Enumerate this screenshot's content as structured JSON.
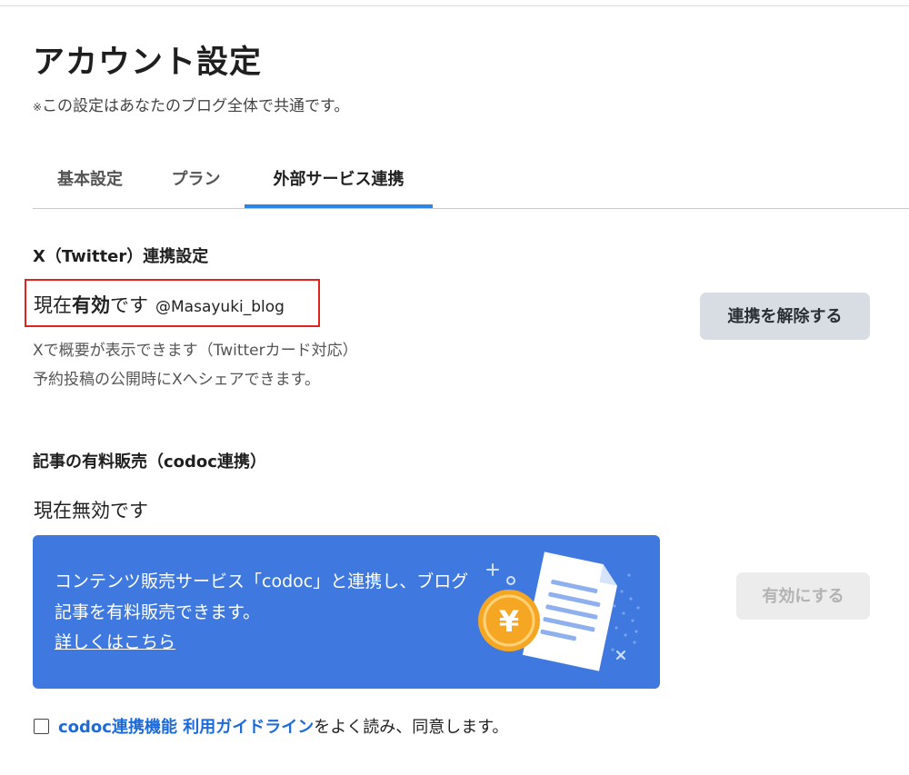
{
  "page": {
    "title": "アカウント設定",
    "note_mark": "※",
    "note_text": "この設定はあなたのブログ全体で共通です。"
  },
  "tabs": [
    {
      "label": "基本設定",
      "active": false
    },
    {
      "label": "プラン",
      "active": false
    },
    {
      "label": "外部サービス連携",
      "active": true
    }
  ],
  "twitter": {
    "heading": "X（Twitter）連携設定",
    "status_prefix": "現在",
    "status_bold": "有効",
    "status_suffix": "です",
    "handle": "@Masayuki_blog",
    "desc_1": "Xで概要が表示できます（Twitterカード対応）",
    "desc_2": "予約投稿の公開時にXへシェアできます。",
    "unlink_button": "連携を解除する"
  },
  "codoc": {
    "heading": "記事の有料販売（codoc連携）",
    "status": "現在無効です",
    "banner_text": "コンテンツ販売サービス「codoc」と連携し、ブログ記事を有料販売できます。",
    "banner_link": "詳しくはこちら",
    "enable_button": "有効にする",
    "coin_symbol": "¥",
    "agree_link": "codoc連携機能 利用ガイドライン",
    "agree_text": "をよく読み、同意します。",
    "agree_checked": false
  },
  "colors": {
    "accent": "#2b84e6",
    "banner_bg": "#3f79e0",
    "link": "#1d6ad9",
    "highlight_border": "#e0231c",
    "coin": "#f5a623"
  },
  "icons": {
    "banner_illustration": "document-icon",
    "coin": "yen-coin-icon"
  }
}
